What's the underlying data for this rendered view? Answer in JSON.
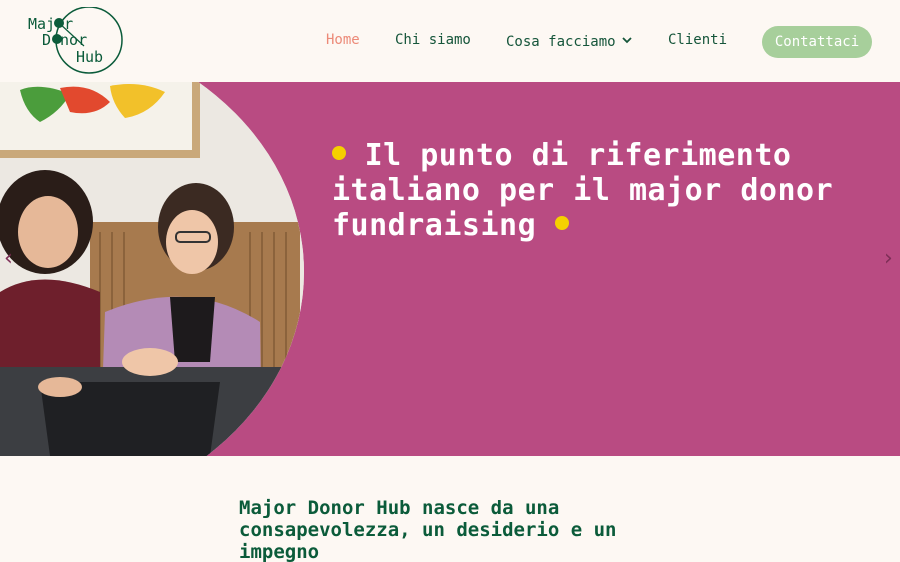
{
  "logo": {
    "line1": "Maj",
    "line1b": "r",
    "line2a": "D",
    "line2b": "nor",
    "line3": "Hub"
  },
  "nav": {
    "items": [
      {
        "label": "Home"
      },
      {
        "label": "Chi siamo"
      },
      {
        "label": "Cosa facciamo"
      },
      {
        "label": "Clienti"
      }
    ],
    "cta": "Contattaci"
  },
  "hero": {
    "title": "Il punto di riferimento italiano per il major donor fundraising",
    "prev_arrow": "‹",
    "next_arrow": "›"
  },
  "intro": {
    "heading": "Major Donor Hub nasce da una consapevolezza, un desiderio e un impegno"
  },
  "colors": {
    "brand_green": "#0b5b3a",
    "hero_magenta": "#b94b82",
    "accent_yellow": "#f5d000",
    "cta_green": "#a7cf9b",
    "active_link": "#ec8a78"
  },
  "icons": [
    "chevron-down-icon",
    "arrow-left-icon",
    "arrow-right-icon"
  ]
}
